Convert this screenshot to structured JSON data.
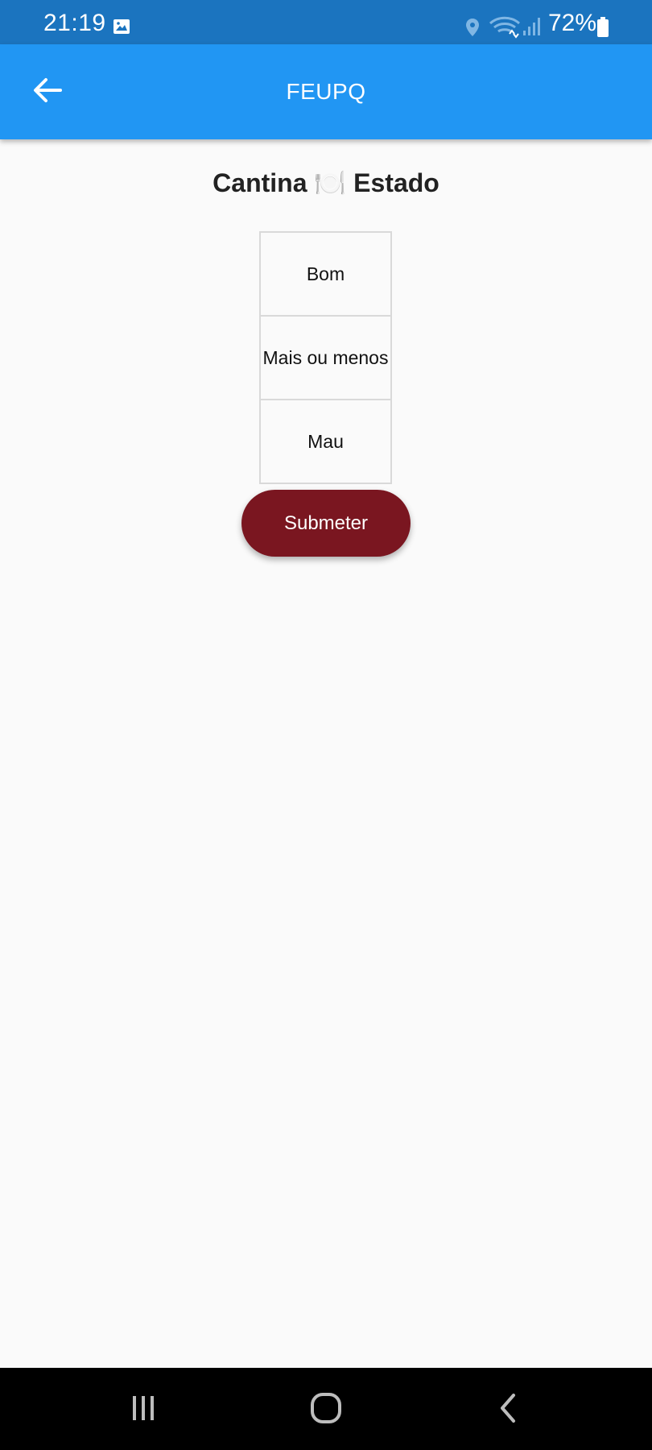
{
  "status_bar": {
    "time": "21:19",
    "battery": "72%",
    "icons": [
      "gallery-icon",
      "location-icon",
      "wifi-icon",
      "signal-icon",
      "battery-icon"
    ]
  },
  "app_bar": {
    "title": "FEUPQ",
    "back_icon": "arrow-left-icon"
  },
  "main": {
    "title": "Cantina 🍽️ Estado",
    "options": [
      {
        "label": "Bom"
      },
      {
        "label": "Mais ou menos"
      },
      {
        "label": "Mau"
      }
    ],
    "submit_label": "Submeter"
  },
  "nav_bar": {
    "icons": [
      "recents-icon",
      "home-icon",
      "back-icon"
    ]
  },
  "colors": {
    "status_bar": "#1b74bf",
    "app_bar": "#2196f3",
    "submit_button": "#7a1620",
    "background": "#fafafa",
    "nav_bar": "#000000"
  }
}
